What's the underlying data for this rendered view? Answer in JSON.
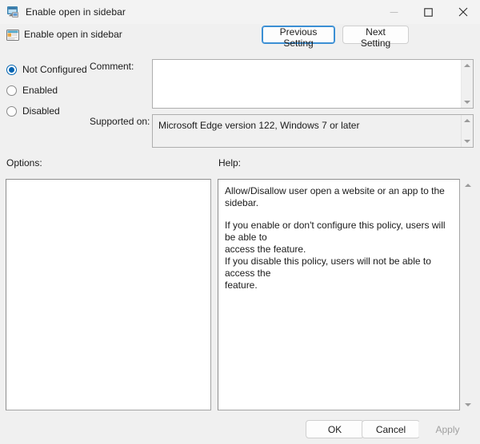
{
  "window": {
    "title": "Enable open in sidebar",
    "icon": "policy-editor-icon",
    "controls": {
      "minimize": "minimize-icon",
      "maximize": "maximize-icon",
      "close": "close-icon"
    }
  },
  "header": {
    "policy_icon": "policy-setting-icon",
    "policy_name": "Enable open in sidebar",
    "previous_setting_label": "Previous Setting",
    "next_setting_label": "Next Setting"
  },
  "state": {
    "options": [
      {
        "id": "not-configured",
        "label": "Not Configured",
        "selected": true
      },
      {
        "id": "enabled",
        "label": "Enabled",
        "selected": false
      },
      {
        "id": "disabled",
        "label": "Disabled",
        "selected": false
      }
    ]
  },
  "comment": {
    "label": "Comment:",
    "value": "",
    "placeholder": ""
  },
  "supported_on": {
    "label": "Supported on:",
    "value": "Microsoft Edge version 122, Windows 7 or later"
  },
  "options_section": {
    "label": "Options:",
    "content": ""
  },
  "help_section": {
    "label": "Help:",
    "paragraph1": "Allow/Disallow user open a website or an app to the sidebar.",
    "paragraph2_line1": "If you enable or don't configure this policy, users will be able to",
    "paragraph2_line2": "access the feature.",
    "paragraph2_line3": "If you disable this policy, users will not be able to access the",
    "paragraph2_line4": "feature."
  },
  "footer": {
    "ok_label": "OK",
    "cancel_label": "Cancel",
    "apply_label": "Apply",
    "apply_disabled": true
  },
  "colors": {
    "accent": "#0063b1",
    "focus_border": "#3b8fd4",
    "window_bg": "#f0f0f0",
    "field_bg": "#ffffff",
    "disabled_text": "#a0a0a0"
  }
}
